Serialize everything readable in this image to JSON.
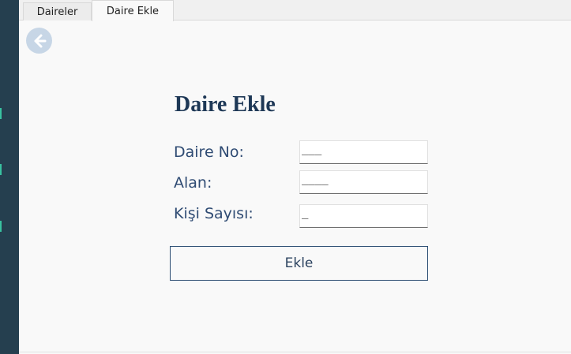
{
  "tabs": [
    {
      "label": "Daireler"
    },
    {
      "label": "Daire Ekle"
    }
  ],
  "back_button": {
    "icon": "arrow-left-icon"
  },
  "form": {
    "title": "Daire Ekle",
    "fields": [
      {
        "label": "Daire No:",
        "value": "___"
      },
      {
        "label": "Alan:",
        "value": "____"
      },
      {
        "label": "Kişi Sayısı:",
        "value": "_"
      }
    ],
    "submit_label": "Ekle"
  },
  "colors": {
    "sidebar": "#253f4f",
    "accent": "#39c2a0",
    "title": "#1e3856",
    "label": "#2f4b73",
    "back_button": "#c7d6e6"
  }
}
